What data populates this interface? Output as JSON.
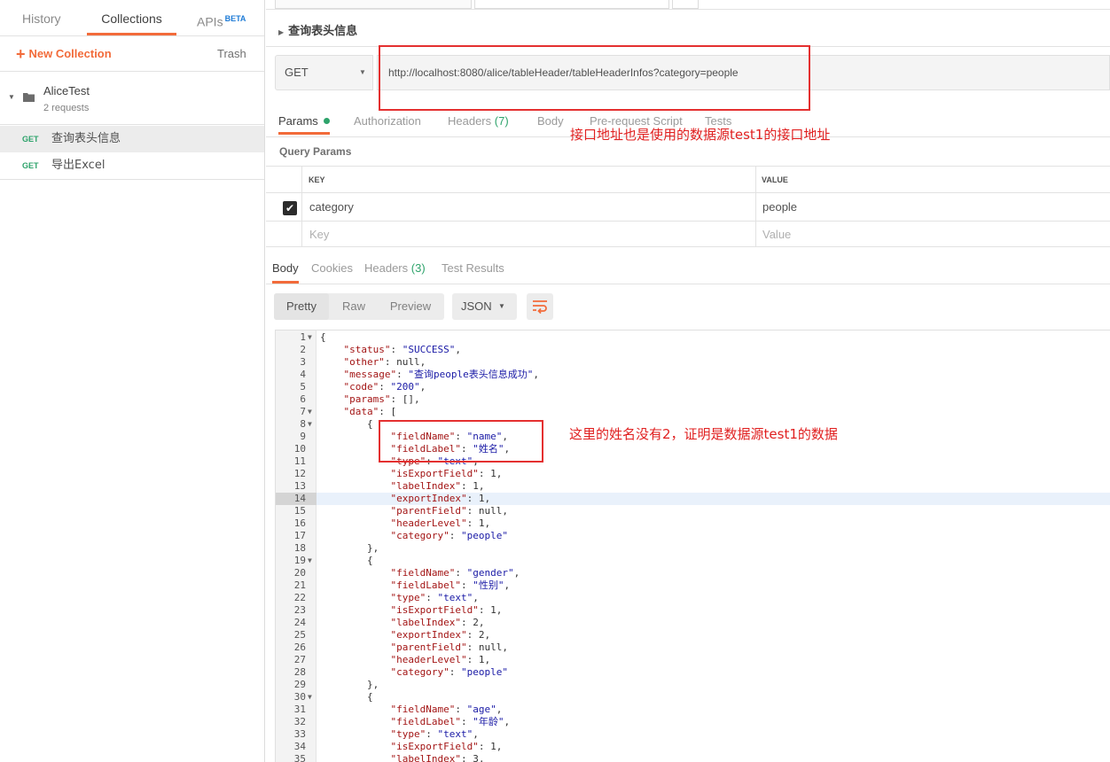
{
  "sidebar": {
    "tabs": [
      {
        "label": "History"
      },
      {
        "label": "Collections"
      },
      {
        "label": "APIs"
      }
    ],
    "beta": "BETA",
    "new_collection": "New Collection",
    "trash": "Trash",
    "collection": {
      "name": "AliceTest",
      "count": "2 requests"
    },
    "requests": [
      {
        "method": "GET",
        "name": "查询表头信息"
      },
      {
        "method": "GET",
        "name": "导出Excel"
      }
    ]
  },
  "request": {
    "title": "查询表头信息",
    "method": "GET",
    "url": "http://localhost:8080/alice/tableHeader/tableHeaderInfos?category=people",
    "tabs": [
      {
        "label": "Params"
      },
      {
        "label": "Authorization"
      },
      {
        "label": "Headers",
        "count": "(7)"
      },
      {
        "label": "Body"
      },
      {
        "label": "Pre-request Script"
      },
      {
        "label": "Tests"
      }
    ],
    "query_params_label": "Query Params",
    "columns": {
      "key": "KEY",
      "value": "VALUE"
    },
    "rows": [
      {
        "key": "category",
        "value": "people"
      }
    ],
    "placeholder": {
      "key": "Key",
      "value": "Value"
    }
  },
  "response": {
    "tabs": [
      {
        "label": "Body"
      },
      {
        "label": "Cookies"
      },
      {
        "label": "Headers",
        "count": "(3)"
      },
      {
        "label": "Test Results"
      }
    ],
    "view_modes": [
      "Pretty",
      "Raw",
      "Preview"
    ],
    "format": "JSON",
    "lines": [
      "{",
      "    \"status\": \"SUCCESS\",",
      "    \"other\": null,",
      "    \"message\": \"查询people表头信息成功\",",
      "    \"code\": \"200\",",
      "    \"params\": [],",
      "    \"data\": [",
      "        {",
      "            \"fieldName\": \"name\",",
      "            \"fieldLabel\": \"姓名\",",
      "            \"type\": \"text\",",
      "            \"isExportField\": 1,",
      "            \"labelIndex\": 1,",
      "            \"exportIndex\": 1,",
      "            \"parentField\": null,",
      "            \"headerLevel\": 1,",
      "            \"category\": \"people\"",
      "        },",
      "        {",
      "            \"fieldName\": \"gender\",",
      "            \"fieldLabel\": \"性别\",",
      "            \"type\": \"text\",",
      "            \"isExportField\": 1,",
      "            \"labelIndex\": 2,",
      "            \"exportIndex\": 2,",
      "            \"parentField\": null,",
      "            \"headerLevel\": 1,",
      "            \"category\": \"people\"",
      "        },",
      "        {",
      "            \"fieldName\": \"age\",",
      "            \"fieldLabel\": \"年龄\",",
      "            \"type\": \"text\",",
      "            \"isExportField\": 1,",
      "            \"labelIndex\": 3,"
    ],
    "fold_lines": [
      1,
      7,
      8,
      19,
      30
    ],
    "highlight_line": 14
  },
  "annotations": {
    "url_note": "接口地址也是使用的数据源test1的接口地址",
    "data_note": "这里的姓名没有2，证明是数据源test1的数据"
  },
  "colors": {
    "accent": "#f26b3a",
    "get": "#2ea36b",
    "annotation": "#e43030"
  }
}
